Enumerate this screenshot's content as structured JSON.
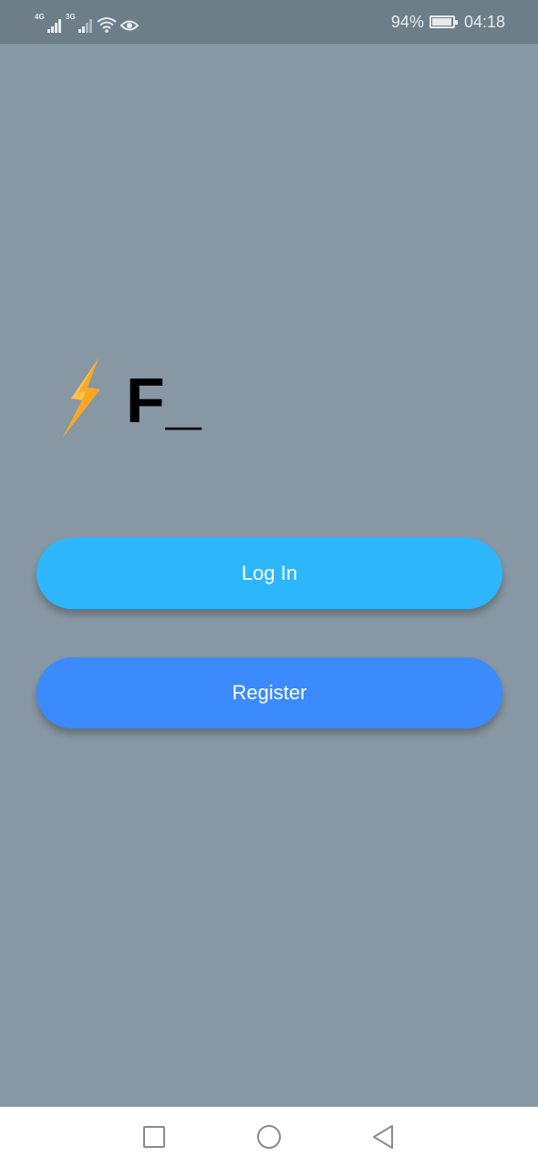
{
  "status_bar": {
    "network_1": "4G",
    "network_2": "3G",
    "wifi_icon": "wifi-icon",
    "eye_icon": "eye-icon",
    "battery_percent": "94%",
    "battery_level": 0.94,
    "time": "04:18"
  },
  "logo": {
    "icon": "lightning-bolt-icon",
    "text": "F_",
    "icon_color": "#f9a825"
  },
  "buttons": {
    "login_label": "Log In",
    "register_label": "Register"
  },
  "nav_bar": {
    "recents": "square-icon",
    "home": "circle-icon",
    "back": "triangle-back-icon"
  },
  "colors": {
    "background": "#8797a3",
    "status_bar": "#6e7e89",
    "login_button": "#2eb6fc",
    "register_button": "#3b8bfd"
  }
}
